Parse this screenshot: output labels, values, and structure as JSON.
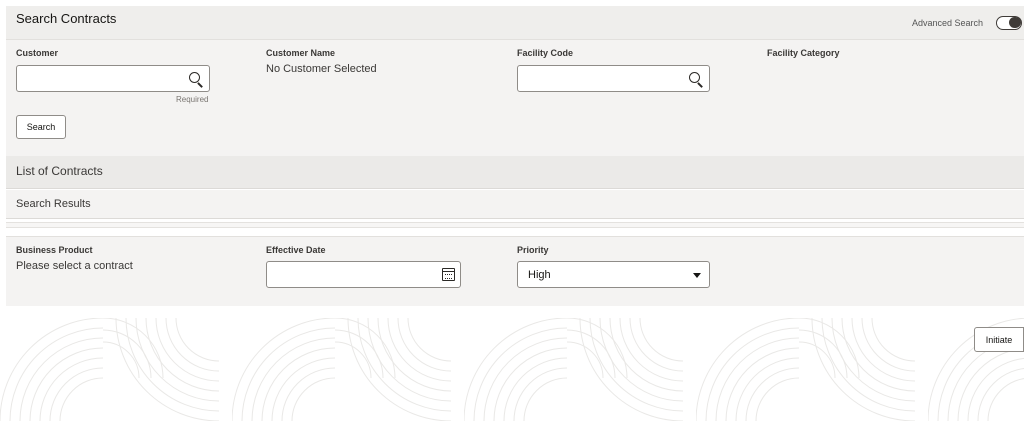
{
  "search_panel": {
    "title": "Search Contracts",
    "advanced_search_label": "Advanced Search",
    "customer_label": "Customer",
    "customer_value": "",
    "customer_required": "Required",
    "customer_name_label": "Customer Name",
    "customer_name_value": "No Customer Selected",
    "facility_code_label": "Facility Code",
    "facility_code_value": "",
    "facility_category_label": "Facility Category",
    "search_button": "Search"
  },
  "contracts": {
    "title": "List of Contracts",
    "results_label": "Search Results"
  },
  "details": {
    "business_product_label": "Business Product",
    "business_product_value": "Please select a contract",
    "effective_date_label": "Effective Date",
    "effective_date_value": "",
    "priority_label": "Priority",
    "priority_value": "High"
  },
  "actions": {
    "initiate_button": "Initiate"
  }
}
